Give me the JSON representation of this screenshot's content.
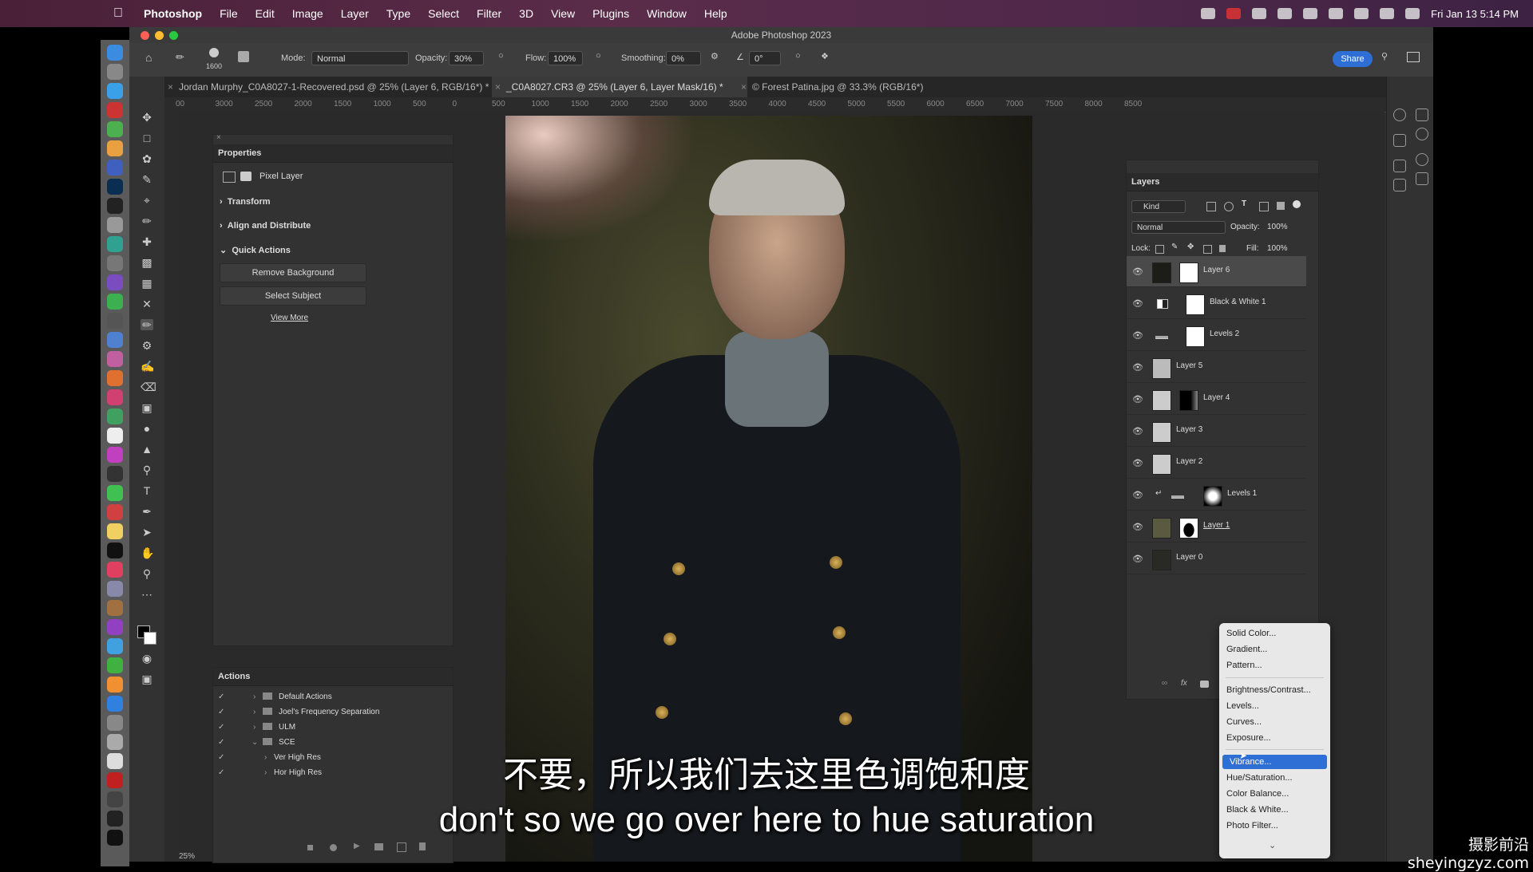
{
  "menubar": {
    "app": "Photoshop",
    "items": [
      "File",
      "Edit",
      "Image",
      "Layer",
      "Type",
      "Select",
      "Filter",
      "3D",
      "View",
      "Plugins",
      "Window",
      "Help"
    ],
    "clock": "Fri Jan 13  5:14 PM"
  },
  "window": {
    "title": "Adobe Photoshop 2023"
  },
  "options": {
    "brush_size": "1600",
    "mode_label": "Mode:",
    "mode_value": "Normal",
    "opacity_label": "Opacity:",
    "opacity_value": "30%",
    "flow_label": "Flow:",
    "flow_value": "100%",
    "smoothing_label": "Smoothing:",
    "smoothing_value": "0%",
    "angle_value": "0°",
    "share_label": "Share"
  },
  "tabs": [
    {
      "label": "Jordan Murphy_C0A8027-1-Recovered.psd @ 25% (Layer 6, RGB/16*) *"
    },
    {
      "label": "_C0A8027.CR3 @ 25% (Layer 6, Layer Mask/16) *"
    },
    {
      "label": "© Forest Patina.jpg @ 33.3% (RGB/16*)"
    }
  ],
  "ruler": [
    "00",
    "3000",
    "2500",
    "2000",
    "1500",
    "1000",
    "500",
    "0",
    "500",
    "1000",
    "1500",
    "2000",
    "2500",
    "3000",
    "3500",
    "4000",
    "4500",
    "5000",
    "5500",
    "6000",
    "6500",
    "7000",
    "7500",
    "8000",
    "8500"
  ],
  "properties": {
    "title": "Properties",
    "kind": "Pixel Layer",
    "sections": [
      "Transform",
      "Align and Distribute",
      "Quick Actions"
    ],
    "btn_remove_bg": "Remove Background",
    "btn_select_subject": "Select Subject",
    "view_more": "View More"
  },
  "actions": {
    "title": "Actions",
    "items": [
      "Default Actions",
      "Joel's Frequency Separation",
      "ULM",
      "SCE",
      "Ver High Res",
      "Hor High Res"
    ]
  },
  "zoom": "25%",
  "layers": {
    "title": "Layers",
    "kind_label": "Kind",
    "blend_mode": "Normal",
    "opacity_label": "Opacity:",
    "opacity_value": "100%",
    "lock_label": "Lock:",
    "fill_label": "Fill:",
    "fill_value": "100%",
    "rows": [
      "Layer 6",
      "Black & White 1",
      "Levels 2",
      "Layer 5",
      "Layer 4",
      "Layer 3",
      "Layer 2",
      "Levels 1",
      "Layer 1",
      "Layer 0"
    ]
  },
  "adjust_menu": {
    "group1": [
      "Solid Color...",
      "Gradient...",
      "Pattern..."
    ],
    "group2": [
      "Brightness/Contrast...",
      "Levels...",
      "Curves...",
      "Exposure..."
    ],
    "group3": [
      "Vibrance...",
      "Hue/Saturation...",
      "Color Balance...",
      "Black & White...",
      "Photo Filter..."
    ]
  },
  "subtitles": {
    "cn": "不要，所以我们去这里色调饱和度",
    "en": "don't so we go over here to hue saturation"
  },
  "watermark": "摄影前沿 sheyingzyz.com",
  "colors": {
    "accent": "#2e6fd6",
    "panel": "#323232",
    "menubar": "#4a2038"
  }
}
